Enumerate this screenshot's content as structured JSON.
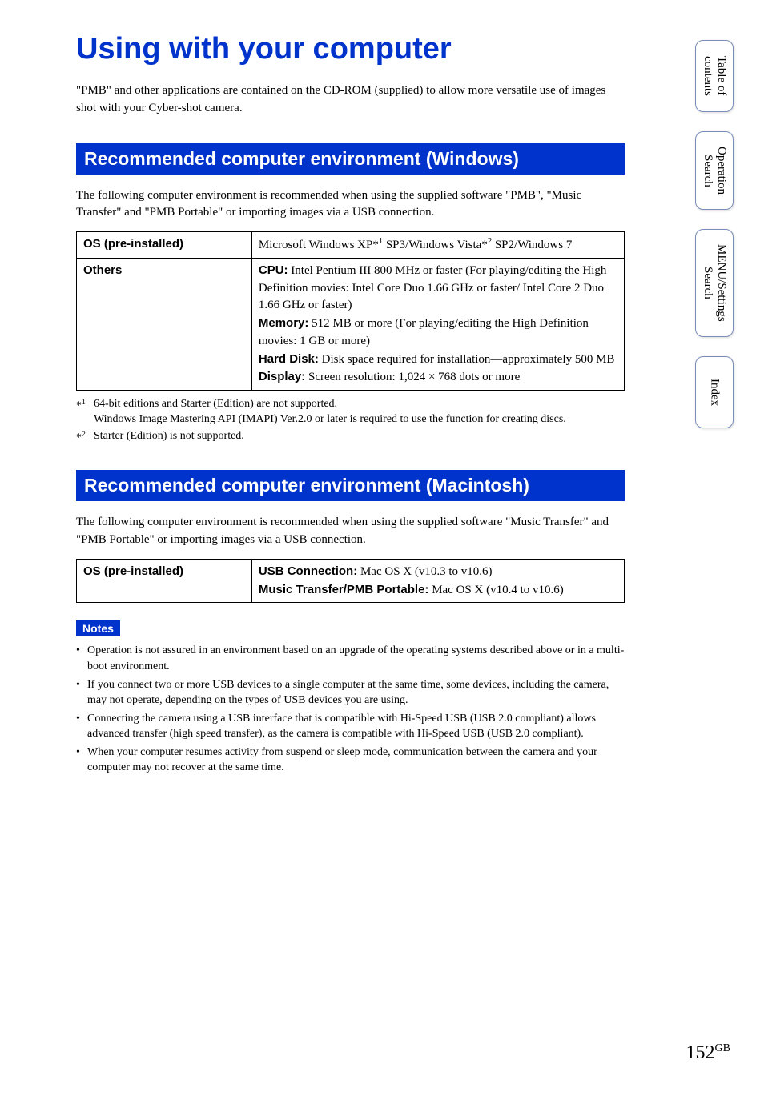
{
  "title": "Using with your computer",
  "intro": "\"PMB\" and other applications are contained on the CD-ROM (supplied) to allow more versatile use of images shot with your Cyber-shot camera.",
  "side_tabs": [
    {
      "label": "Table of\ncontents"
    },
    {
      "label": "Operation\nSearch"
    },
    {
      "label": "MENU/Settings\nSearch"
    },
    {
      "label": "Index"
    }
  ],
  "section_windows": {
    "header": "Recommended computer environment (Windows)",
    "intro": "The following computer environment is recommended when using the supplied software \"PMB\", \"Music Transfer\" and \"PMB Portable\" or importing images via a USB connection.",
    "rows": [
      {
        "label": "OS (pre-installed)",
        "value_html": "Microsoft Windows XP*<sup>1</sup> SP3/Windows Vista*<sup>2</sup> SP2/Windows 7"
      },
      {
        "label": "Others",
        "value_html": "<span class=\"bold\">CPU:</span> Intel Pentium III 800 MHz or faster (For playing/editing the High Definition movies: Intel Core Duo 1.66 GHz or faster/ Intel Core 2 Duo 1.66 GHz or faster)<br><span class=\"bold\">Memory:</span> 512 MB or more (For playing/editing the High Definition movies: 1 GB or more)<br><span class=\"bold\">Hard Disk:</span> Disk space required for installation—approximately 500 MB<br><span class=\"bold\">Display:</span> Screen resolution: 1,024 × 768 dots or more"
      }
    ],
    "footnotes": [
      {
        "marker": "*<sup>1</sup>",
        "text": "64-bit editions and Starter (Edition) are not supported.<br>Windows Image Mastering API (IMAPI) Ver.2.0 or later is required to use the function for creating discs."
      },
      {
        "marker": "*<sup>2</sup>",
        "text": "Starter (Edition) is not supported."
      }
    ]
  },
  "section_mac": {
    "header": "Recommended computer environment (Macintosh)",
    "intro": "The following computer environment is recommended when using the supplied software \"Music Transfer\" and \"PMB Portable\" or importing images via a USB connection.",
    "rows": [
      {
        "label": "OS (pre-installed)",
        "value_html": "<span class=\"bold\">USB Connection:</span> Mac OS X (v10.3 to v10.6)<br><span class=\"bold\">Music Transfer/PMB Portable:</span> Mac OS X (v10.4 to v10.6)"
      }
    ]
  },
  "notes": {
    "label": "Notes",
    "items": [
      "Operation is not assured in an environment based on an upgrade of the operating systems described above or in a multi-boot environment.",
      "If you connect two or more USB devices to a single computer at the same time, some devices, including the camera, may not operate, depending on the types of USB devices you are using.",
      "Connecting the camera using a USB interface that is compatible with Hi-Speed USB (USB 2.0 compliant) allows advanced transfer (high speed transfer), as the camera is compatible with Hi-Speed USB (USB 2.0 compliant).",
      "When your computer resumes activity from suspend or sleep mode, communication between the camera and your computer may not recover at the same time."
    ]
  },
  "page_number": "152",
  "page_suffix": "GB"
}
